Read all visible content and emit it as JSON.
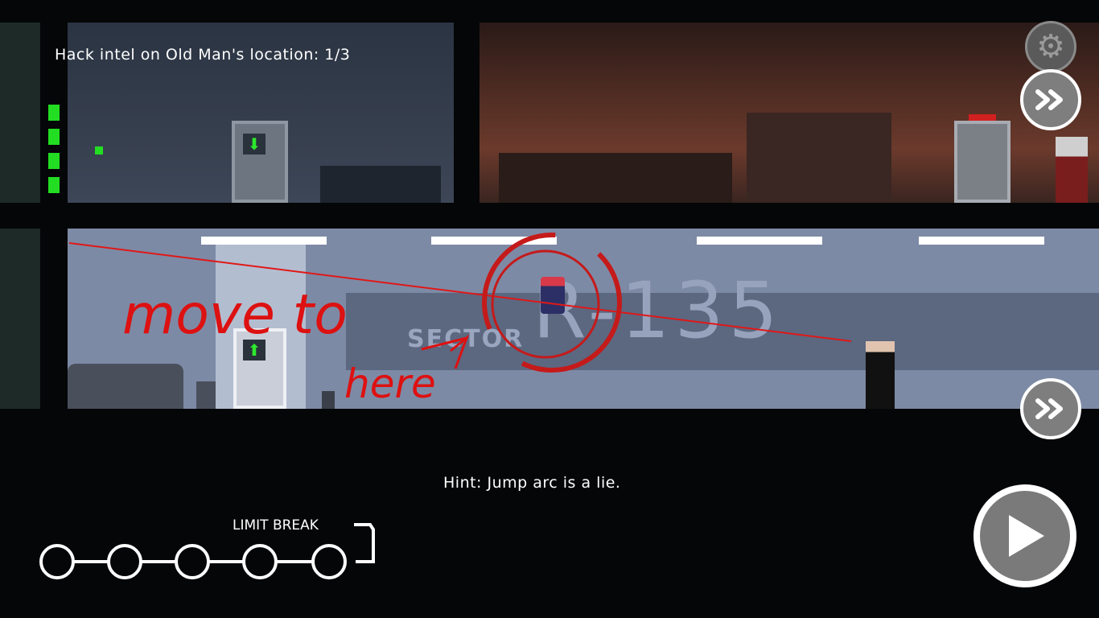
{
  "objective": {
    "text": "Hack intel on Old Man's location: 1/3"
  },
  "hint": {
    "text": "Hint: Jump arc is a lie."
  },
  "limit_break": {
    "label": "LIMIT BREAK",
    "nodes": 5,
    "filled": 0
  },
  "health_bars": 4,
  "sector_sign": {
    "prefix": "SECTOR",
    "code": "R-135"
  },
  "annotation": {
    "line1": "move to",
    "line2": "here"
  },
  "buttons": {
    "settings": "gear-icon",
    "fast_forward_top": "fast-forward-icon",
    "fast_forward_mid": "fast-forward-icon",
    "play": "play-icon"
  },
  "colors": {
    "laser": "#e01818",
    "hud_green": "#22dd22",
    "door_arrow": "#2ee82e",
    "annotation": "#dd1111"
  }
}
